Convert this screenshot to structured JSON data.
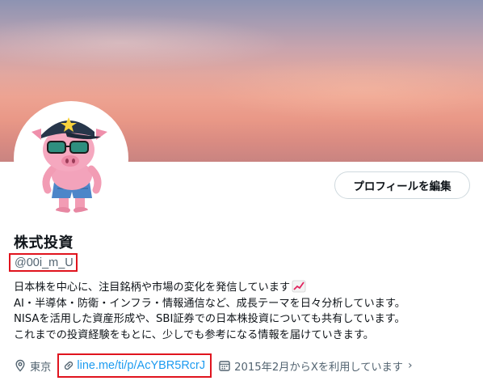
{
  "profile": {
    "display_name": "株式投資",
    "handle": "@00i_m_U",
    "edit_button_label": "プロフィールを編集",
    "bio_lines": [
      "日本株を中心に、注目銘柄や市場の変化を発信しています",
      "AI・半導体・防衛・インフラ・情報通信など、成長テーマを日々分析しています。",
      "NISAを活用した資産形成や、SBI証券での日本株投資についても共有しています。",
      "これまでの投資経験をもとに、少しでも参考になる情報を届けていきます。"
    ],
    "bio_emoji": "chart-increasing-icon",
    "location": "東京",
    "website": "line.me/ti/p/AcYBR5RcrJ",
    "joined": "2015年2月からXを利用しています",
    "joined_chevron": "›"
  },
  "colors": {
    "link": "#1d9bf0",
    "muted": "#536471",
    "highlight_box": "#e0141e"
  }
}
